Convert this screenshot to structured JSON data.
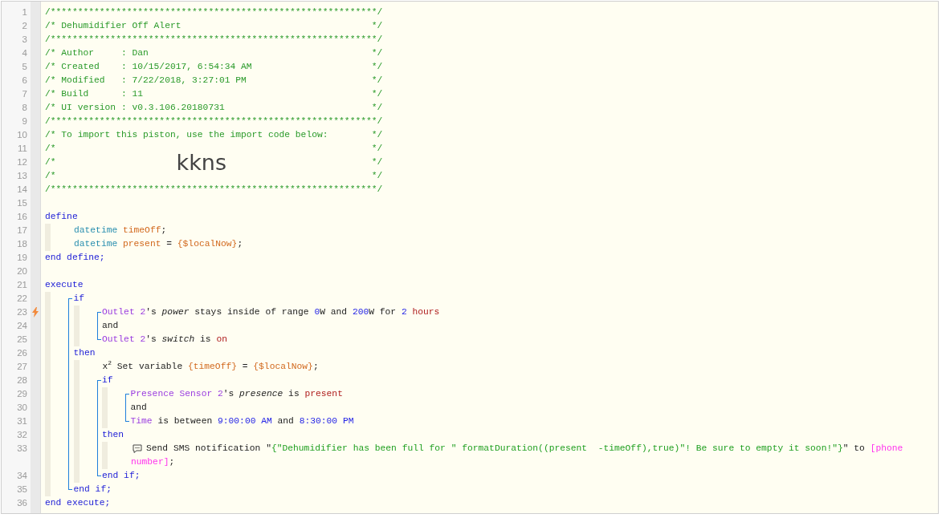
{
  "editor": {
    "code": [
      {
        "kind": "line",
        "number": "1",
        "trigger": false,
        "tokens": [
          {
            "kind": "comment",
            "text": "/************************************************************/"
          }
        ]
      },
      {
        "kind": "line",
        "number": "2",
        "trigger": false,
        "tokens": [
          {
            "kind": "comment",
            "text": "/* Dehumidifier Off Alert"
          },
          {
            "kind": "comment_end",
            "text": "*/"
          }
        ]
      },
      {
        "kind": "line",
        "number": "3",
        "trigger": false,
        "tokens": [
          {
            "kind": "comment",
            "text": "/************************************************************/"
          }
        ]
      },
      {
        "kind": "line",
        "number": "4",
        "trigger": false,
        "tokens": [
          {
            "kind": "comment",
            "text": "/* Author     : Dan"
          },
          {
            "kind": "comment_end",
            "text": "*/"
          }
        ]
      },
      {
        "kind": "line",
        "number": "5",
        "trigger": false,
        "tokens": [
          {
            "kind": "comment",
            "text": "/* Created    : 10/15/2017, 6:54:34 AM"
          },
          {
            "kind": "comment_end",
            "text": "*/"
          }
        ]
      },
      {
        "kind": "line",
        "number": "6",
        "trigger": false,
        "tokens": [
          {
            "kind": "comment",
            "text": "/* Modified   : 7/22/2018, 3:27:01 PM"
          },
          {
            "kind": "comment_end",
            "text": "*/"
          }
        ]
      },
      {
        "kind": "line",
        "number": "7",
        "trigger": false,
        "tokens": [
          {
            "kind": "comment",
            "text": "/* Build      : 11"
          },
          {
            "kind": "comment_end",
            "text": "*/"
          }
        ]
      },
      {
        "kind": "line",
        "number": "8",
        "trigger": false,
        "tokens": [
          {
            "kind": "comment",
            "text": "/* UI version : v0.3.106.20180731"
          },
          {
            "kind": "comment_end",
            "text": "*/"
          }
        ]
      },
      {
        "kind": "line",
        "number": "9",
        "trigger": false,
        "tokens": [
          {
            "kind": "comment",
            "text": "/************************************************************/"
          }
        ]
      },
      {
        "kind": "line",
        "number": "10",
        "trigger": false,
        "tokens": [
          {
            "kind": "comment",
            "text": "/* To import this piston, use the import code below:"
          },
          {
            "kind": "comment_end",
            "text": "*/"
          }
        ]
      },
      {
        "kind": "line",
        "number": "11",
        "trigger": false,
        "tokens": [
          {
            "kind": "comment",
            "text": "/*"
          },
          {
            "kind": "comment_end",
            "text": "*/"
          }
        ]
      },
      {
        "kind": "line",
        "number": "12",
        "trigger": false,
        "tokens": [
          {
            "kind": "comment",
            "text": "/*"
          },
          {
            "kind": "import_code",
            "text": "kkns"
          },
          {
            "kind": "comment_end",
            "text": "*/"
          }
        ]
      },
      {
        "kind": "line",
        "number": "13",
        "trigger": false,
        "tokens": [
          {
            "kind": "comment",
            "text": "/*"
          },
          {
            "kind": "comment_end",
            "text": "*/"
          }
        ]
      },
      {
        "kind": "line",
        "number": "14",
        "trigger": false,
        "tokens": [
          {
            "kind": "comment",
            "text": "/************************************************************/"
          }
        ]
      },
      {
        "kind": "line",
        "number": "15",
        "trigger": false
      },
      {
        "kind": "line",
        "number": "16",
        "trigger": false,
        "tokens": [
          {
            "kind": "keyword",
            "text": "define"
          }
        ]
      },
      {
        "kind": "block",
        "children": [
          {
            "kind": "line",
            "number": "17",
            "trigger": false,
            "tokens": [
              {
                "kind": "type",
                "text": "datetime"
              },
              {
                "kind": "variable",
                "text": "timeOff",
                "gap": true
              },
              {
                "kind": "plain",
                "text": ";"
              }
            ]
          },
          {
            "kind": "line",
            "number": "18",
            "trigger": false,
            "tokens": [
              {
                "kind": "type",
                "text": "datetime"
              },
              {
                "kind": "variable",
                "text": "present",
                "gap": true
              },
              {
                "kind": "plain",
                "text": " = "
              },
              {
                "kind": "variable",
                "text": "{$localNow}"
              },
              {
                "kind": "plain",
                "text": ";"
              }
            ]
          }
        ]
      },
      {
        "kind": "line",
        "number": "19",
        "trigger": false,
        "tokens": [
          {
            "kind": "keyword",
            "text": "end define;"
          }
        ]
      },
      {
        "kind": "line",
        "number": "20",
        "trigger": false
      },
      {
        "kind": "line",
        "number": "21",
        "trigger": false,
        "tokens": [
          {
            "kind": "keyword",
            "text": "execute"
          }
        ]
      },
      {
        "kind": "block",
        "children": [
          {
            "kind": "bracket",
            "children": [
              {
                "kind": "line",
                "number": "22",
                "trigger": false,
                "tokens": [
                  {
                    "kind": "keyword",
                    "text": "if"
                  }
                ]
              },
              {
                "kind": "block",
                "children": [
                  {
                    "kind": "bracket",
                    "children": [
                      {
                        "kind": "line",
                        "number": "23",
                        "trigger": true,
                        "tokens": [
                          {
                            "kind": "device",
                            "text": "Outlet 2"
                          },
                          {
                            "kind": "plain",
                            "text": "'s "
                          },
                          {
                            "kind": "attribute",
                            "text": "power"
                          },
                          {
                            "kind": "plain",
                            "text": " stays inside of range "
                          },
                          {
                            "kind": "number",
                            "text": "0"
                          },
                          {
                            "kind": "plain",
                            "text": "W and "
                          },
                          {
                            "kind": "number",
                            "text": "200"
                          },
                          {
                            "kind": "plain",
                            "text": "W for "
                          },
                          {
                            "kind": "number",
                            "text": "2"
                          },
                          {
                            "kind": "value",
                            "text": "hours",
                            "gap": true
                          }
                        ]
                      },
                      {
                        "kind": "line",
                        "number": "24",
                        "trigger": false,
                        "tokens": [
                          {
                            "kind": "plain",
                            "text": "and"
                          }
                        ]
                      },
                      {
                        "kind": "line",
                        "number": "25",
                        "trigger": false,
                        "tokens": [
                          {
                            "kind": "device",
                            "text": "Outlet 2"
                          },
                          {
                            "kind": "plain",
                            "text": "'s "
                          },
                          {
                            "kind": "attribute",
                            "text": "switch"
                          },
                          {
                            "kind": "plain",
                            "text": " is "
                          },
                          {
                            "kind": "value",
                            "text": "on"
                          }
                        ]
                      }
                    ]
                  }
                ]
              },
              {
                "kind": "line",
                "number": "26",
                "trigger": false,
                "tokens": [
                  {
                    "kind": "keyword",
                    "text": "then"
                  }
                ]
              },
              {
                "kind": "block",
                "children": [
                  {
                    "kind": "line",
                    "number": "27",
                    "trigger": false,
                    "tokens": [
                      {
                        "kind": "markup",
                        "text": "x$^{2}$ Set variable "
                      },
                      {
                        "kind": "variable",
                        "text": "{timeOff}"
                      },
                      {
                        "kind": "plain",
                        "text": " = "
                      },
                      {
                        "kind": "variable",
                        "text": "{$localNow}"
                      },
                      {
                        "kind": "plain",
                        "text": ";"
                      }
                    ]
                  },
                  {
                    "kind": "bracket",
                    "children": [
                      {
                        "kind": "line",
                        "number": "28",
                        "trigger": false,
                        "tokens": [
                          {
                            "kind": "keyword",
                            "text": "if"
                          }
                        ]
                      },
                      {
                        "kind": "block",
                        "children": [
                          {
                            "kind": "bracket",
                            "children": [
                              {
                                "kind": "line",
                                "number": "29",
                                "trigger": false,
                                "tokens": [
                                  {
                                    "kind": "device",
                                    "text": "Presence Sensor 2"
                                  },
                                  {
                                    "kind": "plain",
                                    "text": "'s "
                                  },
                                  {
                                    "kind": "attribute",
                                    "text": "presence"
                                  },
                                  {
                                    "kind": "plain",
                                    "text": " is "
                                  },
                                  {
                                    "kind": "value",
                                    "text": "present"
                                  }
                                ]
                              },
                              {
                                "kind": "line",
                                "number": "30",
                                "trigger": false,
                                "tokens": [
                                  {
                                    "kind": "plain",
                                    "text": "and"
                                  }
                                ]
                              },
                              {
                                "kind": "line",
                                "number": "31",
                                "trigger": false,
                                "tokens": [
                                  {
                                    "kind": "device",
                                    "text": "Time"
                                  },
                                  {
                                    "kind": "plain",
                                    "text": " is between "
                                  },
                                  {
                                    "kind": "number",
                                    "text": "9:00:00 AM"
                                  },
                                  {
                                    "kind": "plain",
                                    "text": " and "
                                  },
                                  {
                                    "kind": "number",
                                    "text": "8:30:00 PM"
                                  }
                                ]
                              }
                            ]
                          }
                        ]
                      },
                      {
                        "kind": "line",
                        "number": "32",
                        "trigger": false,
                        "tokens": [
                          {
                            "kind": "keyword",
                            "text": "then"
                          }
                        ]
                      },
                      {
                        "kind": "block",
                        "children": [
                          {
                            "kind": "line",
                            "number": "33",
                            "trigger": false,
                            "tokens": [
                              {
                                "kind": "notify",
                                "text": "Send SMS notification "
                              },
                              {
                                "kind": "plain",
                                "text": "\""
                              },
                              {
                                "kind": "string",
                                "text": "{\"Dehumidifier has been full for \" formatDuration((present  -timeOff),true)\"! Be sure to empty it soon!\"}"
                              },
                              {
                                "kind": "plain",
                                "text": "\" to "
                              },
                              {
                                "kind": "argument",
                                "text": "[phone"
                              }
                            ],
                            "continuation": [
                              {
                                "kind": "argument",
                                "text": "number]"
                              },
                              {
                                "kind": "plain",
                                "text": ";"
                              }
                            ]
                          }
                        ]
                      },
                      {
                        "kind": "line",
                        "number": "34",
                        "trigger": false,
                        "tokens": [
                          {
                            "kind": "keyword",
                            "text": "end if;"
                          }
                        ]
                      }
                    ]
                  }
                ]
              },
              {
                "kind": "line",
                "number": "35",
                "trigger": false,
                "tokens": [
                  {
                    "kind": "keyword",
                    "text": "end if;"
                  }
                ]
              }
            ]
          }
        ]
      },
      {
        "kind": "line",
        "number": "36",
        "trigger": false,
        "tokens": [
          {
            "kind": "keyword",
            "text": "end execute;"
          }
        ]
      }
    ]
  }
}
